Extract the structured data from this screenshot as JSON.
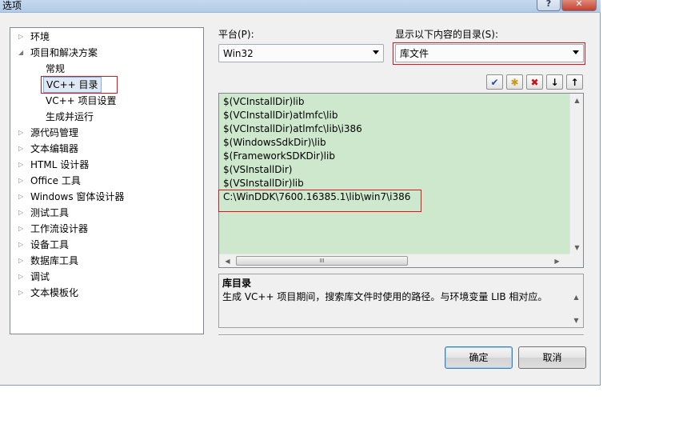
{
  "window": {
    "title": "选项",
    "help_label": "?",
    "close_label": "✕"
  },
  "tree": {
    "items": [
      {
        "label": "环境",
        "expander": "▷"
      },
      {
        "label": "项目和解决方案",
        "expander": "◢"
      },
      {
        "label": "常规",
        "expander": ""
      },
      {
        "label": "VC++ 目录",
        "expander": "",
        "selected": true
      },
      {
        "label": "VC++ 项目设置",
        "expander": ""
      },
      {
        "label": "生成并运行",
        "expander": ""
      },
      {
        "label": "源代码管理",
        "expander": "▷"
      },
      {
        "label": "文本编辑器",
        "expander": "▷"
      },
      {
        "label": "HTML 设计器",
        "expander": "▷"
      },
      {
        "label": "Office 工具",
        "expander": "▷"
      },
      {
        "label": "Windows 窗体设计器",
        "expander": "▷"
      },
      {
        "label": "测试工具",
        "expander": "▷"
      },
      {
        "label": "工作流设计器",
        "expander": "▷"
      },
      {
        "label": "设备工具",
        "expander": "▷"
      },
      {
        "label": "数据库工具",
        "expander": "▷"
      },
      {
        "label": "调试",
        "expander": "▷"
      },
      {
        "label": "文本模板化",
        "expander": "▷"
      }
    ]
  },
  "platform": {
    "label": "平台(P):",
    "value": "Win32"
  },
  "show_dirs": {
    "label": "显示以下内容的目录(S):",
    "value": "库文件"
  },
  "toolbar": {
    "check_icon": "✔",
    "new_folder_icon": "✱",
    "delete_icon": "✖",
    "down_icon": "↓",
    "up_icon": "↑"
  },
  "directories": [
    "$(VCInstallDir)lib",
    "$(VCInstallDir)atlmfc\\lib",
    "$(VCInstallDir)atlmfc\\lib\\i386",
    "$(WindowsSdkDir)\\lib",
    "$(FrameworkSDKDir)lib",
    "$(VSInstallDir)",
    "$(VSInstallDir)lib",
    "C:\\WinDDK\\7600.16385.1\\lib\\win7\\i386"
  ],
  "scroll": {
    "up": "▲",
    "down": "▼",
    "left": "◀",
    "right": "▶",
    "grip": "III"
  },
  "description": {
    "title": "库目录",
    "text": "生成 VC++ 项目期间，搜索库文件时使用的路径。与环境变量 LIB 相对应。"
  },
  "buttons": {
    "ok": "确定",
    "cancel": "取消"
  },
  "colors": {
    "list_background": "#cde8cd",
    "highlight_box": "#e0151b",
    "selection_border": "#84acdd"
  }
}
